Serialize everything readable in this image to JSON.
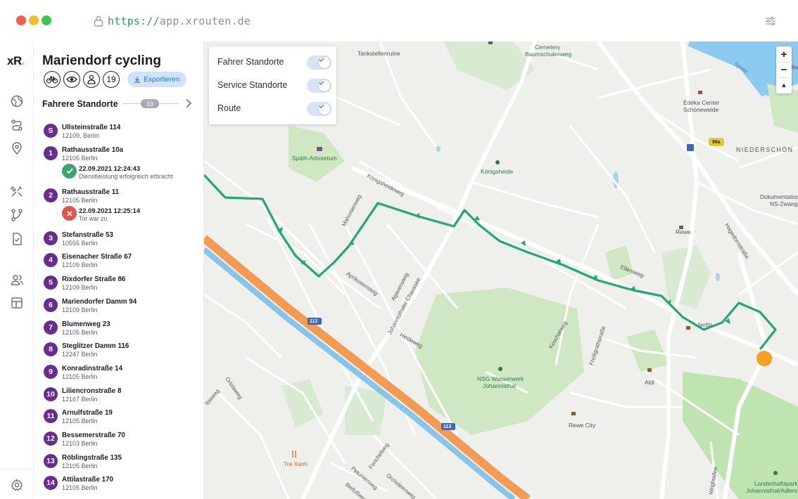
{
  "browser": {
    "url_scheme": "https://",
    "url_host": "app.xrouten.de"
  },
  "app": {
    "logo_text": "xR",
    "logo_dot": ".",
    "accent_color": "#6b2c91",
    "route_color": "#1fa974",
    "rail_icons": [
      "globe-icon",
      "route-icon",
      "location-pin-icon",
      "tools-icon",
      "graph-icon",
      "document-check-icon",
      "users-icon",
      "table-icon",
      "settings-gear-icon"
    ]
  },
  "panel": {
    "title": "Mariendorf cycling",
    "pill_count": "19",
    "export_label": "Exportieren",
    "section_title": "Fahrere Standorte",
    "section_count": "33",
    "stops": [
      {
        "badge": "S",
        "street": "Ullsteinstraße 114",
        "city": "12109, Berlin"
      },
      {
        "badge": "1",
        "street": "Rathausstraße 10a",
        "city": "12105 Berlin",
        "status": {
          "type": "ok",
          "time": "22.09.2021 12:24:43",
          "text": "Dienstleistung erfolgreich erbracht"
        }
      },
      {
        "badge": "2",
        "street": "Rathausstraße 11",
        "city": "12105 Berlin",
        "status": {
          "type": "fail",
          "time": "22.09.2021 12:25:14",
          "text": "Tor war zu"
        }
      },
      {
        "badge": "3",
        "street": "Stefanstraße 53",
        "city": "10555 Berlin"
      },
      {
        "badge": "4",
        "street": "Eisenacher Straße 67",
        "city": "12109 Berlin"
      },
      {
        "badge": "5",
        "street": "Rixdorfer Straße 86",
        "city": "12109 Berlin"
      },
      {
        "badge": "6",
        "street": "Mariendorfer Damm 94",
        "city": "12109 Berlin"
      },
      {
        "badge": "7",
        "street": "Blumenweg 23",
        "city": "12105 Berlin"
      },
      {
        "badge": "8",
        "street": "Steglitzer Damm 116",
        "city": "12247 Berlin"
      },
      {
        "badge": "9",
        "street": "Konradinstraße 14",
        "city": "12105 Berlin"
      },
      {
        "badge": "10",
        "street": "Liliencronstraße 8",
        "city": "12167 Berlin"
      },
      {
        "badge": "11",
        "street": "Arnulfstraße 19",
        "city": "12105 Berlin"
      },
      {
        "badge": "12",
        "street": "Bessemerstraße 70",
        "city": "12103 Berlin"
      },
      {
        "badge": "13",
        "street": "Röblingstraße 135",
        "city": "12105 Berlin"
      },
      {
        "badge": "14",
        "street": "Attilastraße 170",
        "city": "12105 Berlin"
      }
    ]
  },
  "map": {
    "layers": [
      {
        "label": "Fahrer Standorte",
        "enabled": true
      },
      {
        "label": "Service Standorte",
        "enabled": true
      },
      {
        "label": "Route",
        "enabled": true
      }
    ],
    "zoom_in": "+",
    "zoom_out": "−",
    "compass": "▲",
    "places": {
      "tankstellenruine": "Tankstellenruine",
      "cemetery_1": "Cemetery",
      "cemetery_2": "Baumschulenweg",
      "spree": "Spree",
      "edeka_1": "Edeka Center",
      "edeka_2": "Schöneweide",
      "niederschoen": "NIEDERSCHÖN",
      "doku_1": "Dokumentation",
      "doku_2": "NS-Zwang",
      "re_trunc": "Re",
      "spath": "Späth-Arboretum",
      "koenigsheide": "Königsheide",
      "rewe": "Rewe",
      "netto": "Netto",
      "aldi": "Aldi",
      "nsg_1": "NSG Wasserwerk",
      "nsg_2": "Johannisthal",
      "rewe_city": "Rewe City",
      "tre_xanh": "Tre Xanh",
      "landschaft_1": "Landschaftspark",
      "landschaft_2": "Johannisthal/Adlers",
      "b96a": "96a",
      "b113a": "113",
      "b113b": "113"
    },
    "streets": {
      "koenigsheideweg": "Königsheideweg",
      "mahonienweg": "Mahonienweg",
      "aprikosensteig": "Aprikosensteig",
      "agavensteig": "Agavensteig",
      "johannisthaler": "Johannisthaler Chaussee",
      "heideweg": "Heideweg",
      "ellernweg": "Ellernweg",
      "hagedornstrasse": "Hagedornstraße",
      "koschatweg": "Koschatweg",
      "freiligrath": "Freiligrathstraße",
      "orlolaweg": "Orlolaweg",
      "ibisweg": "Ibisweg",
      "fenchelweg": "Fenchelweg",
      "petunienweg": "Petunienweg",
      "orchideenweg": "Orchideenweg",
      "beifussweg": "Beifußweg",
      "wrightallee": "Wrightallee"
    }
  }
}
